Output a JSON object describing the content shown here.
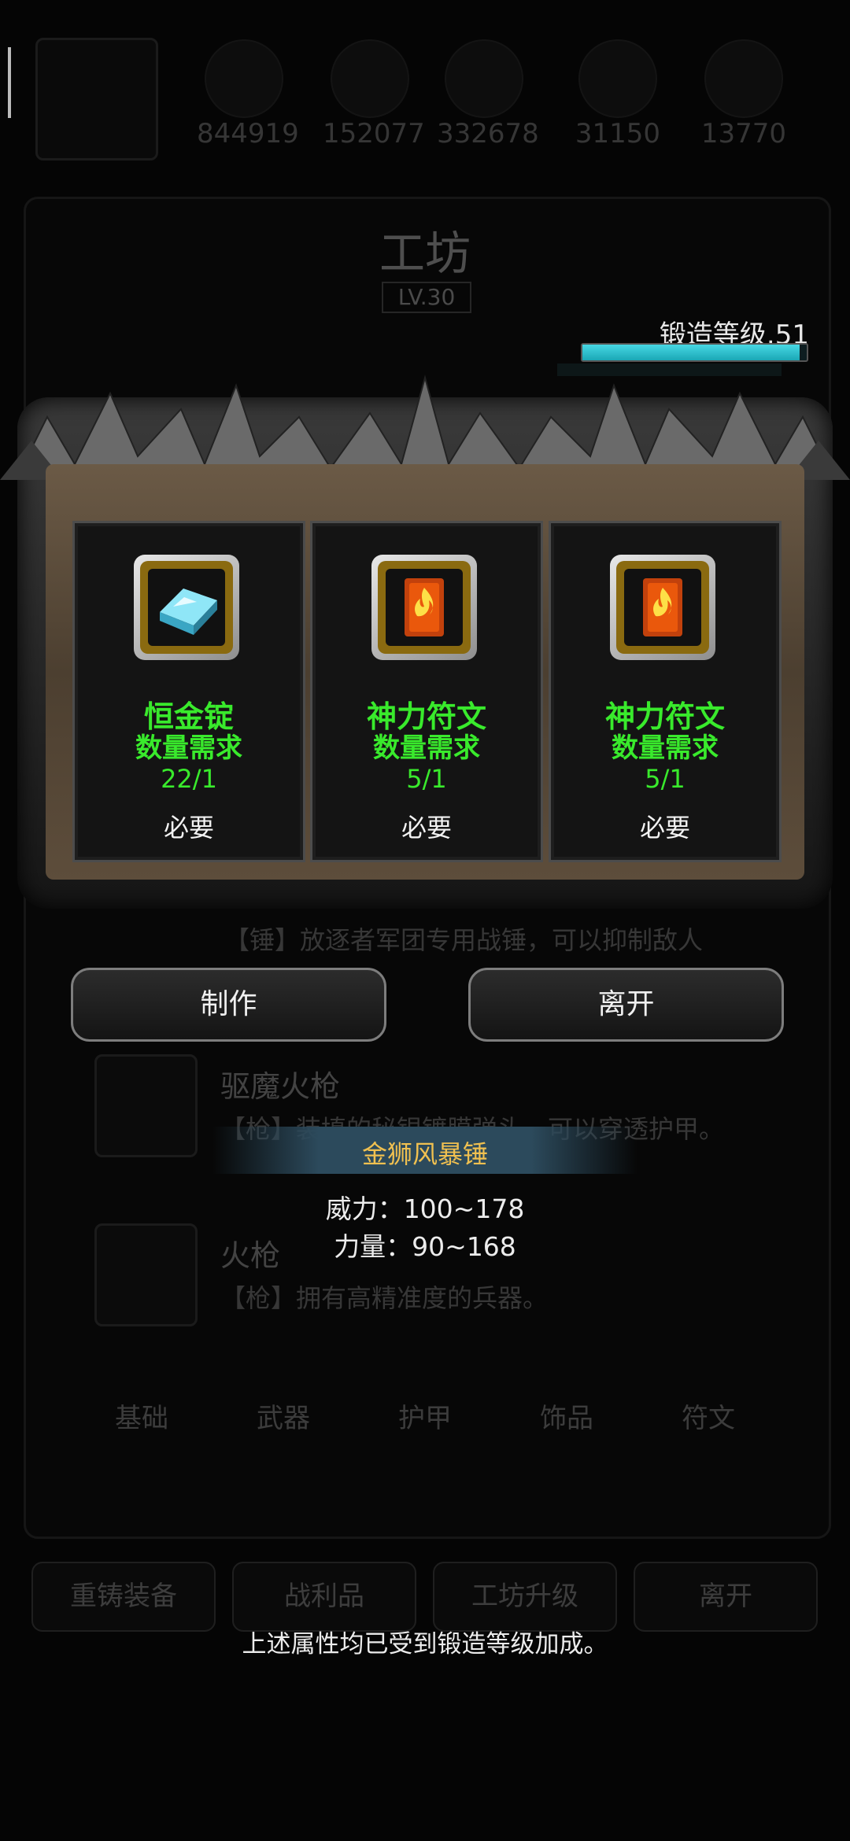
{
  "background": {
    "resources": [
      "844919",
      "152077",
      "332678",
      "31150",
      "13770"
    ],
    "workshop_title": "工坊",
    "workshop_level": "LV.30",
    "items": [
      {
        "name": "",
        "desc": "【锤】放逐者军团专用战锤，可以抑制敌人"
      },
      {
        "name": "驱魔火枪",
        "desc": "【枪】装填的秘银镀膜弹头，可以穿透护甲。"
      },
      {
        "name": "火枪",
        "desc": "【枪】拥有高精准度的兵器。"
      }
    ],
    "categories": [
      "基础",
      "武器",
      "护甲",
      "饰品",
      "符文"
    ],
    "bottom_buttons": [
      "重铸装备",
      "战利品",
      "工坊升级",
      "离开"
    ]
  },
  "forge": {
    "label": "锻造等级.51",
    "progress": 0.97
  },
  "materials": [
    {
      "name": "恒金锭",
      "sub": "数量需求",
      "qty": "22/1",
      "req": "必要",
      "icon": "ingot-icon",
      "color": "#6cd6ef"
    },
    {
      "name": "神力符文",
      "sub": "数量需求",
      "qty": "5/1",
      "req": "必要",
      "icon": "rune-icon",
      "color": "#f07a1a"
    },
    {
      "name": "神力符文",
      "sub": "数量需求",
      "qty": "5/1",
      "req": "必要",
      "icon": "rune-icon",
      "color": "#f07a1a"
    }
  ],
  "actions": {
    "craft": "制作",
    "leave": "离开"
  },
  "tooltip": {
    "title": "金狮风暴锤",
    "power": "威力：100~178",
    "strength": "力量：90~168",
    "note": "上述属性均已受到锻造等级加成。"
  }
}
